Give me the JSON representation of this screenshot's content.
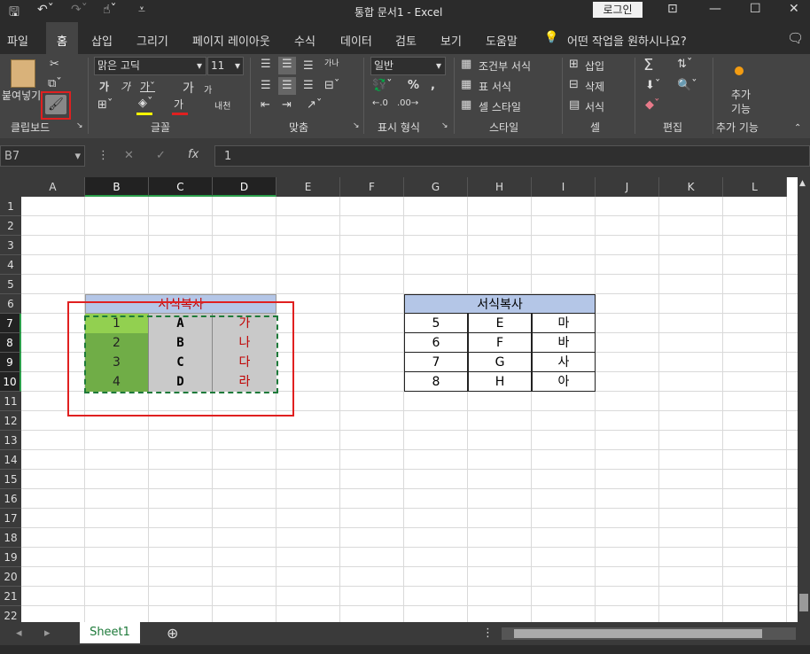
{
  "window": {
    "title": "통합 문서1  -  Excel",
    "login_label": "로그인"
  },
  "tabs": [
    "파일",
    "홈",
    "삽입",
    "그리기",
    "페이지 레이아웃",
    "수식",
    "데이터",
    "검토",
    "보기",
    "도움말"
  ],
  "tell_me": "어떤 작업을 원하시나요?",
  "ribbon": {
    "clipboard": {
      "paste": "붙여넣기",
      "label": "클립보드"
    },
    "font": {
      "name": "맑은 고딕",
      "size": "11",
      "label": "글꼴",
      "bold": "가",
      "italic": "가",
      "grow": "가",
      "shrink": "가",
      "color_sample": "가",
      "phonetic": "내천"
    },
    "align": {
      "label": "맞춤",
      "wrap": "가나"
    },
    "number": {
      "format": "일반",
      "label": "표시 형식",
      "percent": "%"
    },
    "styles": {
      "cond": "조건부 서식",
      "table": "표 서식",
      "cell": "셀 스타일",
      "label": "스타일"
    },
    "cells": {
      "insert": "삽입",
      "delete": "삭제",
      "format": "서식",
      "label": "셀"
    },
    "editing": {
      "label": "편집"
    },
    "addins": {
      "btn": "추가 기능",
      "label": "추가 기능"
    }
  },
  "formula": {
    "namebox": "B7",
    "fx": "fx",
    "value": "1"
  },
  "columns": [
    "A",
    "B",
    "C",
    "D",
    "E",
    "F",
    "G",
    "H",
    "I",
    "J",
    "K",
    "L"
  ],
  "rows": [
    "1",
    "2",
    "3",
    "4",
    "5",
    "6",
    "7",
    "8",
    "9",
    "10",
    "11",
    "12",
    "13",
    "14",
    "15",
    "16",
    "17",
    "18",
    "19",
    "20",
    "21",
    "22"
  ],
  "left_table": {
    "title": "서식복사",
    "rows": [
      [
        "1",
        "A",
        "가"
      ],
      [
        "2",
        "B",
        "나"
      ],
      [
        "3",
        "C",
        "다"
      ],
      [
        "4",
        "D",
        "라"
      ]
    ]
  },
  "right_table": {
    "title": "서식복사",
    "rows": [
      [
        "5",
        "E",
        "마"
      ],
      [
        "6",
        "F",
        "바"
      ],
      [
        "7",
        "G",
        "사"
      ],
      [
        "8",
        "H",
        "아"
      ]
    ]
  },
  "sheet_tab": "Sheet1",
  "colors": {
    "header_blue": "#b4c6e7",
    "green_light": "#92d050",
    "green_dark": "#70ad47",
    "gray": "#c9c9c9",
    "red_text": "#c00000",
    "highlight_red": "#e02020"
  }
}
